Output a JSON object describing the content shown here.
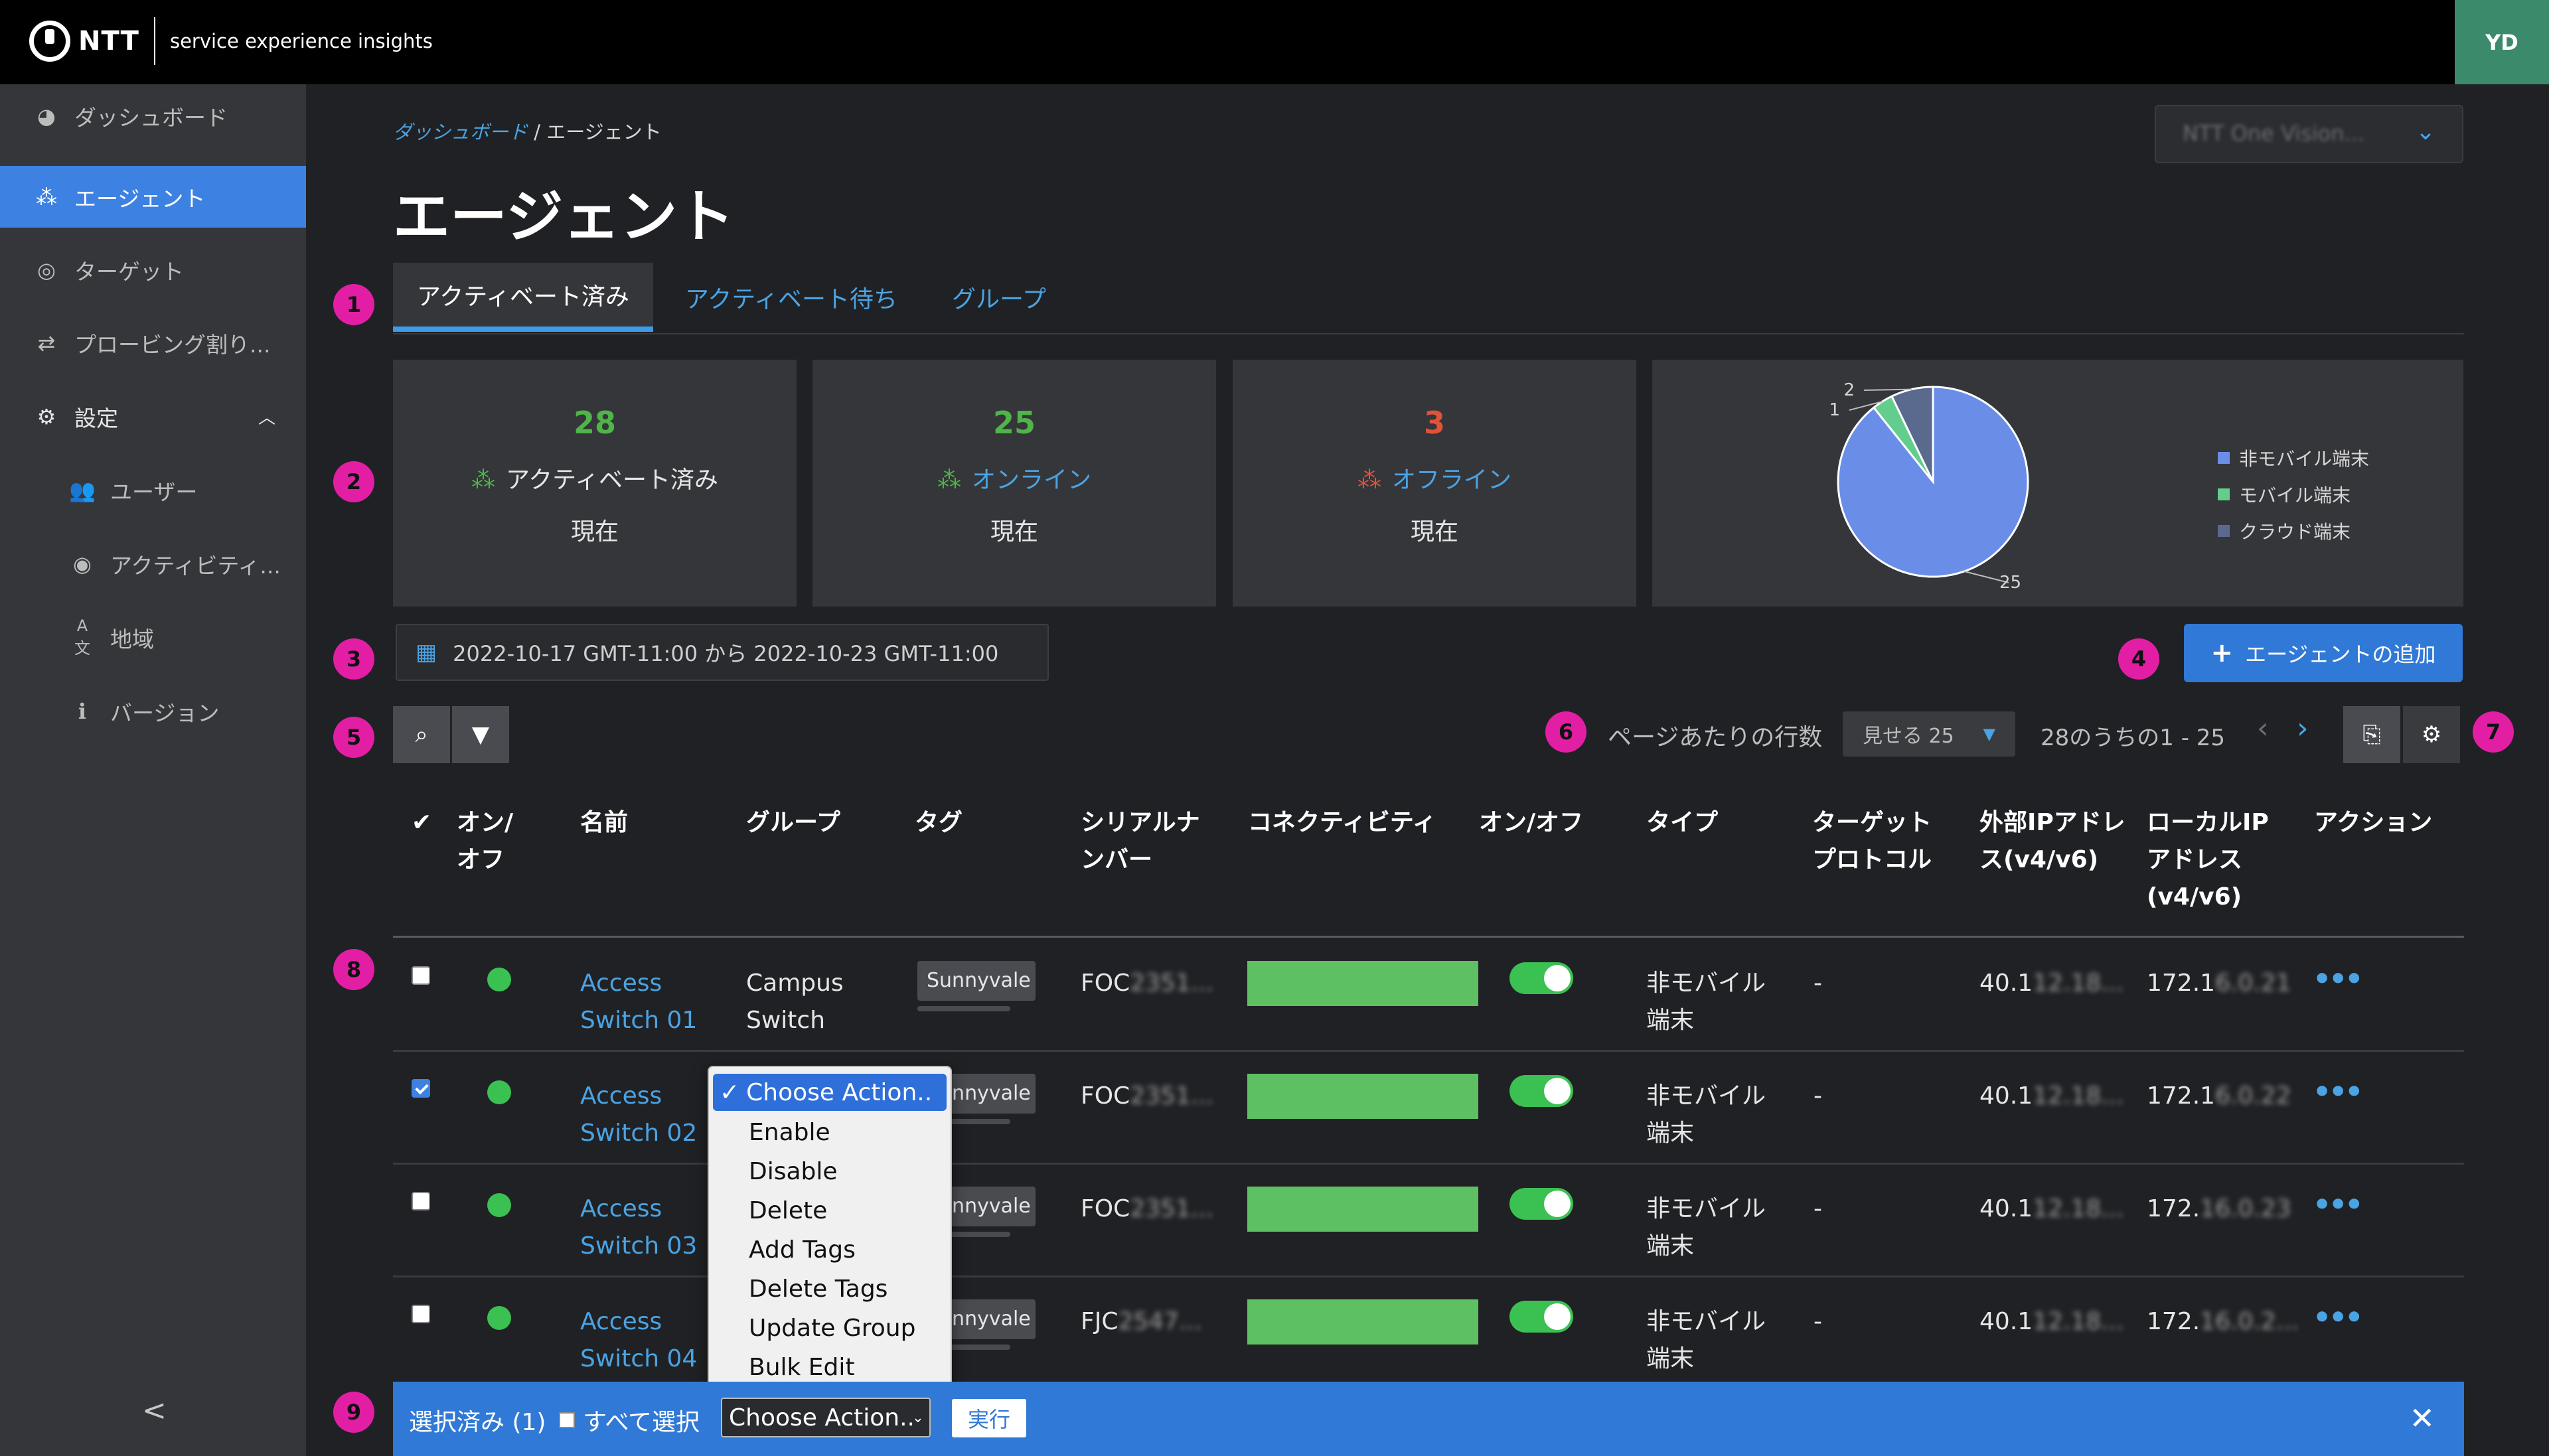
{
  "app": {
    "logo_text": "NTT",
    "subtitle": "service experience insights",
    "user_initials": "YD"
  },
  "sidebar": {
    "items": [
      {
        "label": "ダッシュボード",
        "icon": "speedometer-icon"
      },
      {
        "label": "エージェント",
        "icon": "agent-network-icon",
        "active": true
      },
      {
        "label": "ターゲット",
        "icon": "target-icon"
      },
      {
        "label": "プロービング割り...",
        "icon": "swap-arrows-icon"
      },
      {
        "label": "設定",
        "icon": "gear-icon",
        "expanded": true
      },
      {
        "label": "ユーザー",
        "icon": "users-icon"
      },
      {
        "label": "アクティビティ...",
        "icon": "eye-icon"
      },
      {
        "label": "地域",
        "icon": "language-icon"
      },
      {
        "label": "バージョン",
        "icon": "info-icon"
      }
    ],
    "collapse_label": "<"
  },
  "breadcrumb": {
    "parent": "ダッシュボード",
    "separator": "/",
    "current": "エージェント"
  },
  "org_selector": {
    "value": "NTT One Vision..."
  },
  "page_title": "エージェント",
  "tabs": [
    {
      "label": "アクティベート済み",
      "active": true
    },
    {
      "label": "アクティベート待ち"
    },
    {
      "label": "グループ"
    }
  ],
  "markers": [
    "1",
    "2",
    "3",
    "4",
    "5",
    "6",
    "7",
    "8",
    "9"
  ],
  "summary_cards": [
    {
      "count": "28",
      "label": "アクティベート済み",
      "sub": "現在",
      "color": "#4fb548"
    },
    {
      "count": "25",
      "label": "オンライン",
      "sub": "現在",
      "color": "#4fb548"
    },
    {
      "count": "3",
      "label": "オフライン",
      "sub": "現在",
      "color": "#e0533a"
    }
  ],
  "chart_data": {
    "type": "pie",
    "categories": [
      "非モバイル端末",
      "モバイル端末",
      "クラウド端末"
    ],
    "values": [
      25,
      1,
      2
    ],
    "data_labels": [
      "25",
      "1",
      "2"
    ],
    "colors": [
      "#6a8ee8",
      "#62cd8d",
      "#5a6a8f"
    ],
    "legend_position": "right"
  },
  "date_range": {
    "text": "2022-10-17 GMT-11:00 から 2022-10-23 GMT-11:00"
  },
  "add_agent_button": {
    "label": "エージェントの追加"
  },
  "pagination": {
    "rows_per_page_label": "ページあたりの行数",
    "rows_per_page_value": "見せる 25",
    "range_text": "28のうちの1 - 25"
  },
  "table": {
    "headers": [
      "✔",
      "オン/オフ",
      "名前",
      "グループ",
      "タグ",
      "シリアルナンバー",
      "コネクティビティ",
      "オン/オフ",
      "タイプ",
      "ターゲットプロトコル",
      "外部IPアドレス(v4/v6)",
      "ローカルIPアドレス(v4/v6)",
      "アクション"
    ],
    "rows": [
      {
        "checked": false,
        "name1": "Access",
        "name2": "Switch 01",
        "group1": "Campus",
        "group2": "Switch",
        "tag": "Sunnyvale L",
        "serial": "FOC",
        "serial_hidden": "2351...",
        "type1": "非モバイル",
        "type2": "端末",
        "protocol": "-",
        "ext_ip": "40.1",
        "ext_hidden": "12.18...",
        "local_ip": "172.1",
        "local_hidden": "6.0.21"
      },
      {
        "checked": true,
        "name1": "Access",
        "name2": "Switch 02",
        "group1": "",
        "group2": "",
        "tag": "Sunnyvale L",
        "serial": "FOC",
        "serial_hidden": "2351...",
        "type1": "非モバイル",
        "type2": "端末",
        "protocol": "-",
        "ext_ip": "40.1",
        "ext_hidden": "12.18...",
        "local_ip": "172.1",
        "local_hidden": "6.0.22"
      },
      {
        "checked": false,
        "name1": "Access",
        "name2": "Switch 03",
        "group1": "",
        "group2": "",
        "tag": "Sunnyvale L",
        "serial": "FOC",
        "serial_hidden": "2351...",
        "type1": "非モバイル",
        "type2": "端末",
        "protocol": "-",
        "ext_ip": "40.1",
        "ext_hidden": "12.18...",
        "local_ip": "172.",
        "local_hidden": "16.0.23"
      },
      {
        "checked": false,
        "name1": "Access",
        "name2": "Switch 04",
        "group1": "",
        "group2": "",
        "tag": "Sunnyvale L",
        "serial": "FJC",
        "serial_hidden": "2547...",
        "type1": "非モバイル",
        "type2": "端末",
        "protocol": "-",
        "ext_ip": "40.1",
        "ext_hidden": "12.18...",
        "local_ip": "172.",
        "local_hidden": "16.0.2..."
      }
    ]
  },
  "action_dropdown": {
    "options": [
      "Choose Action..",
      "Enable",
      "Disable",
      "Delete",
      "Add Tags",
      "Delete Tags",
      "Update Group",
      "Bulk Edit"
    ],
    "selected": "Choose Action.."
  },
  "bulk_bar": {
    "selected_label": "選択済み (1)",
    "select_all_label": "すべて選択",
    "action_value": "Choose Action..",
    "run_label": "実行"
  }
}
